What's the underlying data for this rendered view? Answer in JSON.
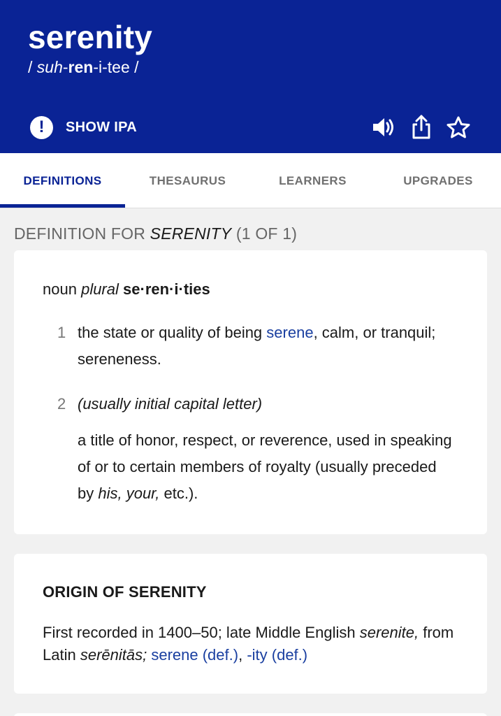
{
  "header": {
    "word": "serenity",
    "pron": {
      "open": "/ ",
      "syl1": "suh",
      "dash1": "-",
      "syl2": "ren",
      "rest": "-i-tee",
      "close": " /"
    },
    "show_ipa_label": "SHOW IPA",
    "ipa_icon": "exclamation-icon",
    "icons": [
      "speaker-icon",
      "share-icon",
      "star-icon"
    ]
  },
  "tabs": [
    {
      "label": "DEFINITIONS",
      "active": true
    },
    {
      "label": "THESAURUS",
      "active": false
    },
    {
      "label": "LEARNERS",
      "active": false
    },
    {
      "label": "UPGRADES",
      "active": false
    }
  ],
  "section": {
    "prefix": "DEFINITION FOR ",
    "word": "SERENITY",
    "suffix": " (1 OF 1)"
  },
  "entry": {
    "pos": "noun",
    "plural_label": "plural",
    "plural_form": "se·ren·i·ties",
    "definitions": [
      {
        "num": "1",
        "text_before": "the state or quality of being ",
        "link": "serene",
        "text_after": ", calm, or tranquil; sereneness."
      },
      {
        "num": "2",
        "qualifier": "(usually initial capital letter)",
        "text_before": "a title of honor, respect, or reverence, used in speaking of or to certain members of royalty (usually preceded by ",
        "italic": "his, your,",
        "text_after": " etc.)."
      }
    ]
  },
  "origin": {
    "heading": "ORIGIN OF SERENITY",
    "text1": "First recorded in 1400–50; late Middle English ",
    "italic1": "serenite,",
    "text2": " from Latin ",
    "italic2": "serēnitās;",
    "text3": " ",
    "link1": "serene (def.)",
    "sep": ", ",
    "link2": "-ity (def.)"
  },
  "colors": {
    "brand_blue": "#0a2395",
    "link_blue": "#1a3fa0",
    "background": "#f1f1f1"
  }
}
